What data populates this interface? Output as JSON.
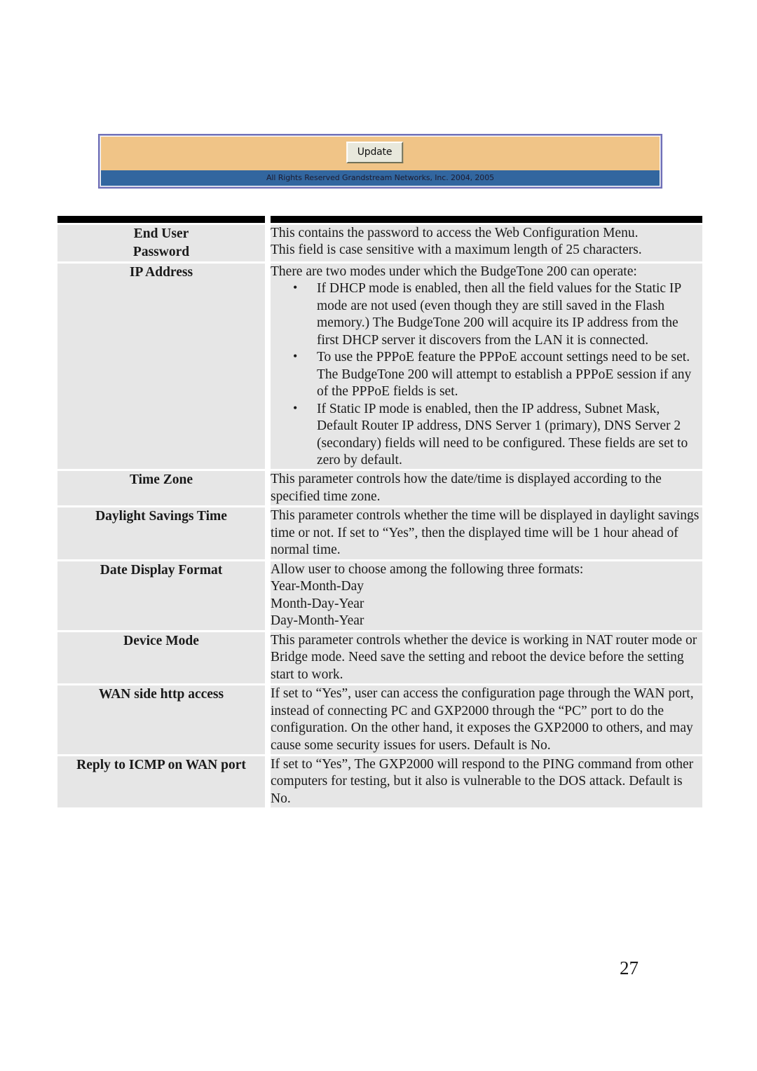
{
  "web_panel": {
    "update_button_label": "Update",
    "footer_text": "All Rights Reserved Grandstream Networks, Inc. 2004, 2005",
    "colors": {
      "toolbar_background": "#f0c487",
      "footer_background": "#32669f",
      "panel_border": "#7070b8",
      "button_face": "#e8e8dc"
    }
  },
  "param_table": {
    "colors": {
      "row_background": "#e6e6e6",
      "top_rule": "#000000",
      "gutter": "#ffffff"
    },
    "rows": [
      {
        "label_lines": [
          "End User",
          "Password"
        ],
        "paragraphs": [
          "This contains the password to access the Web Configuration Menu.",
          "This field is case sensitive with a maximum length of 25 characters."
        ],
        "bullets": []
      },
      {
        "label_lines": [
          "IP Address"
        ],
        "paragraphs": [
          "There are two modes under which the BudgeTone 200 can operate:"
        ],
        "bullets": [
          "If DHCP mode is enabled, then all the field values for the Static IP mode are not used (even though they are still saved in the Flash memory.) The BudgeTone 200 will acquire its IP address from the first DHCP server it discovers from the LAN it is connected.",
          "To use the PPPoE feature the PPPoE account settings need to be set. The BudgeTone 200 will attempt to establish a PPPoE session if any of the PPPoE fields is set.",
          "If Static IP mode is enabled, then the IP address, Subnet Mask, Default Router IP address, DNS Server 1 (primary), DNS Server 2 (secondary) fields will need to be configured. These fields are set to zero by default."
        ]
      },
      {
        "label_lines": [
          "Time Zone"
        ],
        "paragraphs": [
          "This parameter controls how the date/time is displayed according to the specified time zone."
        ],
        "bullets": []
      },
      {
        "label_lines": [
          "Daylight Savings Time"
        ],
        "paragraphs": [
          "This parameter controls whether the time will be displayed in daylight savings time or not. If set to “Yes”, then the displayed time will be 1 hour ahead of normal time."
        ],
        "bullets": []
      },
      {
        "label_lines": [
          "Date Display Format"
        ],
        "paragraphs": [
          "Allow user to choose among the following three formats:",
          "Year-Month-Day",
          "Month-Day-Year",
          "Day-Month-Year"
        ],
        "bullets": []
      },
      {
        "label_lines": [
          "Device Mode"
        ],
        "paragraphs": [
          "This parameter controls whether the device is working in NAT router mode or Bridge mode. Need save the setting and reboot the device before the setting start to work."
        ],
        "bullets": []
      },
      {
        "label_lines": [
          "WAN side http access"
        ],
        "paragraphs": [
          "If set to “Yes”, user can access the configuration page through the WAN port, instead of connecting PC and GXP2000 through the “PC” port to do the configuration. On the other hand, it exposes the GXP2000 to others, and may cause some security issues for users. Default is No."
        ],
        "bullets": []
      },
      {
        "label_lines": [
          "Reply to ICMP on WAN port"
        ],
        "paragraphs": [
          "If set to “Yes”, The GXP2000 will respond to the PING command from other computers for testing, but it also is vulnerable to the DOS attack. Default is No."
        ],
        "bullets": []
      }
    ]
  },
  "page_number": "27"
}
